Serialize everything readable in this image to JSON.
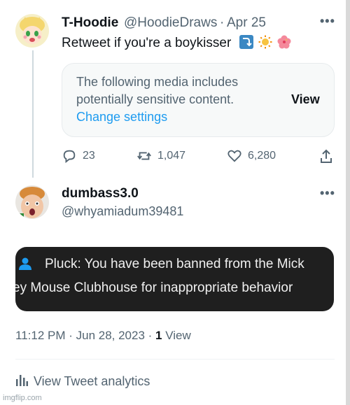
{
  "tweet1": {
    "display_name": "T-Hoodie",
    "handle": "@HoodieDraws",
    "separator": "·",
    "date": "Apr 25",
    "text": "Retweet if you're a boykisser",
    "emojis": [
      "curved-arrow-icon",
      "sun-icon",
      "hibiscus-icon"
    ],
    "sensitive_notice": {
      "message": "The following media includes potentially sensitive content.",
      "change_settings": "Change settings",
      "view": "View"
    },
    "actions": {
      "replies": "23",
      "retweets": "1,047",
      "likes": "6,280"
    }
  },
  "tweet2": {
    "display_name": "dumbass3.0",
    "handle": "@whyamiadum39481",
    "media_card": {
      "line1": "Pluck:   You have been banned from the Mick",
      "line2": "ey Mouse Clubhouse for inappropriate behavior"
    },
    "time": "11:12 PM · Jun 28, 2023 ·",
    "views_count": "1",
    "views_label": "View",
    "analytics": "View Tweet analytics"
  },
  "watermark": "imgflip.com",
  "colors": {
    "link": "#1d9bf0",
    "secondary_text": "#536471",
    "primary_text": "#0f1419",
    "dark_card": "#1f1f1f"
  }
}
